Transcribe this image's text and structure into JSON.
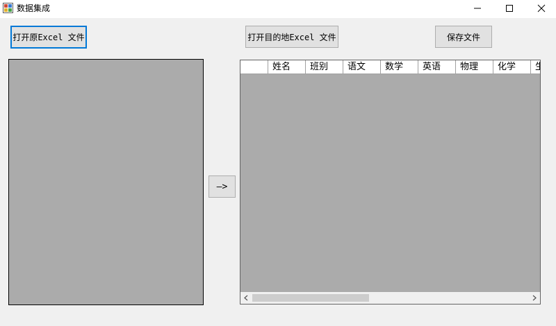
{
  "window": {
    "title": "数据集成"
  },
  "toolbar": {
    "open_source_label": "打开原Excel 文件",
    "open_target_label": "打开目的地Excel 文件",
    "save_label": "保存文件"
  },
  "transfer": {
    "arrow_label": "—>"
  },
  "grid": {
    "columns": [
      "姓名",
      "班别",
      "语文",
      "数学",
      "英语",
      "物理",
      "化学",
      "生"
    ]
  },
  "colors": {
    "panel_bg": "#ababab",
    "focus_border": "#0078d7",
    "button_bg": "#e1e1e1"
  },
  "icons": [
    "app-icon",
    "minimize-icon",
    "maximize-icon",
    "close-icon",
    "scroll-left-icon",
    "scroll-right-icon"
  ]
}
